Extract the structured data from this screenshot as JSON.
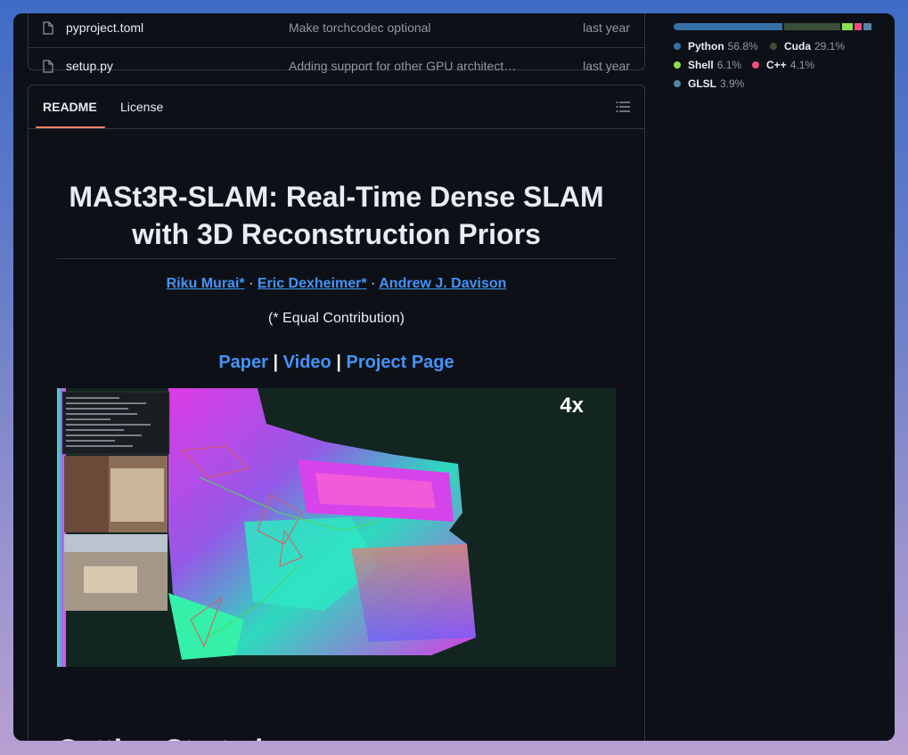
{
  "files": [
    {
      "name": "pyproject.toml",
      "message": "Make torchcodec optional",
      "time": "last year"
    },
    {
      "name": "setup.py",
      "message": "Adding support for other GPU architect…",
      "time": "last year"
    }
  ],
  "readme_tabs": {
    "active": "README",
    "other": "License"
  },
  "readme": {
    "title": "MASt3R-SLAM: Real-Time Dense SLAM with 3D Reconstruction Priors",
    "authors": [
      "Riku Murai*",
      "Eric Dexheimer*",
      "Andrew J. Davison"
    ],
    "author_separator": "·",
    "equal_contribution": "(* Equal Contribution)",
    "links": [
      "Paper",
      "Video",
      "Project Page"
    ],
    "link_separator": "|",
    "media_overlay": "4x",
    "next_heading": "Getting Started"
  },
  "languages": [
    {
      "name": "Python",
      "percent": "56.8%",
      "value": 56.8,
      "color": "#3572A5"
    },
    {
      "name": "Cuda",
      "percent": "29.1%",
      "value": 29.1,
      "color": "#3A4E3A"
    },
    {
      "name": "Shell",
      "percent": "6.1%",
      "value": 6.1,
      "color": "#89e051"
    },
    {
      "name": "C++",
      "percent": "4.1%",
      "value": 4.1,
      "color": "#f34b7d"
    },
    {
      "name": "GLSL",
      "percent": "3.9%",
      "value": 3.9,
      "color": "#5686a5"
    }
  ]
}
